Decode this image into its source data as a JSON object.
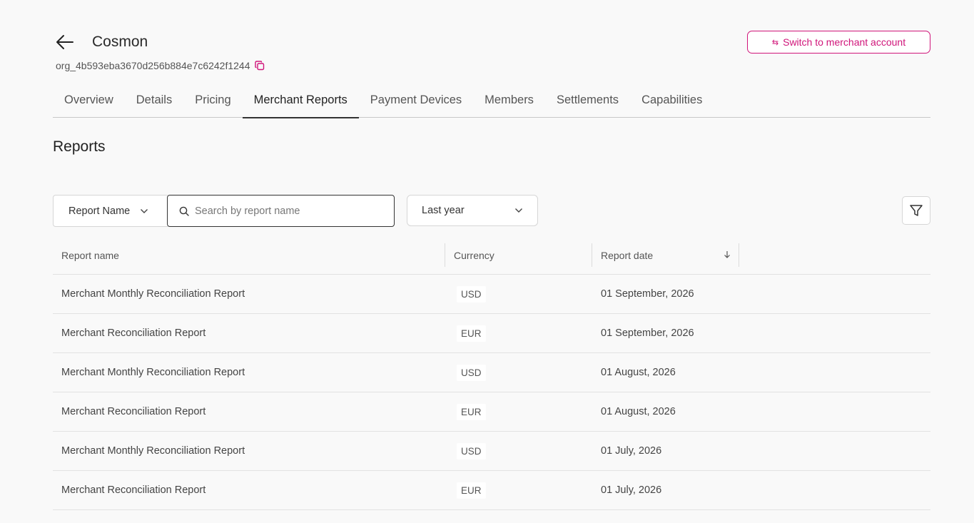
{
  "header": {
    "org_name": "Cosmon",
    "org_id": "org_4b593eba3670d256b884e7c6242f1244",
    "switch_label": "Switch to merchant account"
  },
  "tabs": [
    {
      "label": "Overview"
    },
    {
      "label": "Details"
    },
    {
      "label": "Pricing"
    },
    {
      "label": "Merchant Reports",
      "active": true
    },
    {
      "label": "Payment Devices"
    },
    {
      "label": "Members"
    },
    {
      "label": "Settlements"
    },
    {
      "label": "Capabilities"
    }
  ],
  "section": {
    "title": "Reports"
  },
  "filters": {
    "field_select": "Report Name",
    "search_placeholder": "Search by report name",
    "date_range": "Last year"
  },
  "table": {
    "columns": [
      "Report name",
      "Currency",
      "Report date"
    ],
    "rows": [
      {
        "name": "Merchant Monthly Reconciliation Report",
        "currency": "USD",
        "date": "01 September, 2026"
      },
      {
        "name": "Merchant Reconciliation Report",
        "currency": "EUR",
        "date": "01 September, 2026"
      },
      {
        "name": "Merchant Monthly Reconciliation Report",
        "currency": "USD",
        "date": "01 August, 2026"
      },
      {
        "name": "Merchant Reconciliation Report",
        "currency": "EUR",
        "date": "01 August, 2026"
      },
      {
        "name": "Merchant Monthly Reconciliation Report",
        "currency": "USD",
        "date": "01 July, 2026"
      },
      {
        "name": "Merchant Reconciliation Report",
        "currency": "EUR",
        "date": "01 July, 2026"
      }
    ]
  },
  "colors": {
    "accent": "#d0157a",
    "text": "#333333",
    "border": "#d6d6d6",
    "background": "#f9f9f9"
  },
  "icons": [
    "arrow-left-icon",
    "copy-icon",
    "switch-arrows-icon",
    "chevron-down-icon",
    "search-icon",
    "filter-icon",
    "sort-down-icon"
  ]
}
